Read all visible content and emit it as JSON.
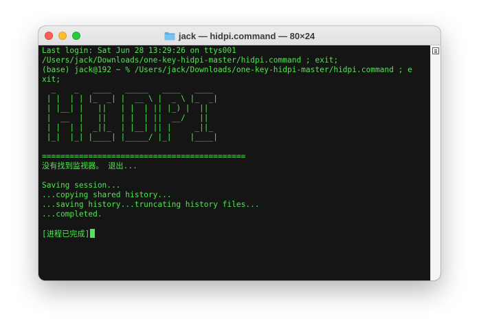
{
  "window": {
    "title": "jack — hidpi.command — 80×24",
    "title_icon": "folder-icon"
  },
  "terminal": {
    "lines": [
      "Last login: Sat Jun 28 13:29:26 on ttys001",
      "/Users/jack/Downloads/one-key-hidpi-master/hidpi.command ; exit;",
      "(base) jack@192 ~ % /Users/jack/Downloads/one-key-hidpi-master/hidpi.command ; e",
      "xit;"
    ],
    "banner": [
      "  _    _   ____   _____   ____   ____",
      " | |  | | |_  _| |  __ \\ |  _ \\ |_  _|",
      " | |__| |   ||   | |  | || |_) |  ||",
      " |  __  |   ||   | |  | ||  __/   ||",
      " | |  | |  _||_  | |__| || |     _||_",
      " |_|  |_| |____| |_____/ |_|    |____|"
    ],
    "separator": "============================================",
    "messages": [
      "没有找到监视器。 退出...",
      "",
      "Saving session...",
      "...copying shared history...",
      "...saving history...truncating history files...",
      "...completed.",
      ""
    ],
    "final_line": "[进程已完成]",
    "text_color": "#4ee84e",
    "background_color": "#151515"
  },
  "scrollbar": {
    "marker_icon": "scroll-marker-icon"
  }
}
